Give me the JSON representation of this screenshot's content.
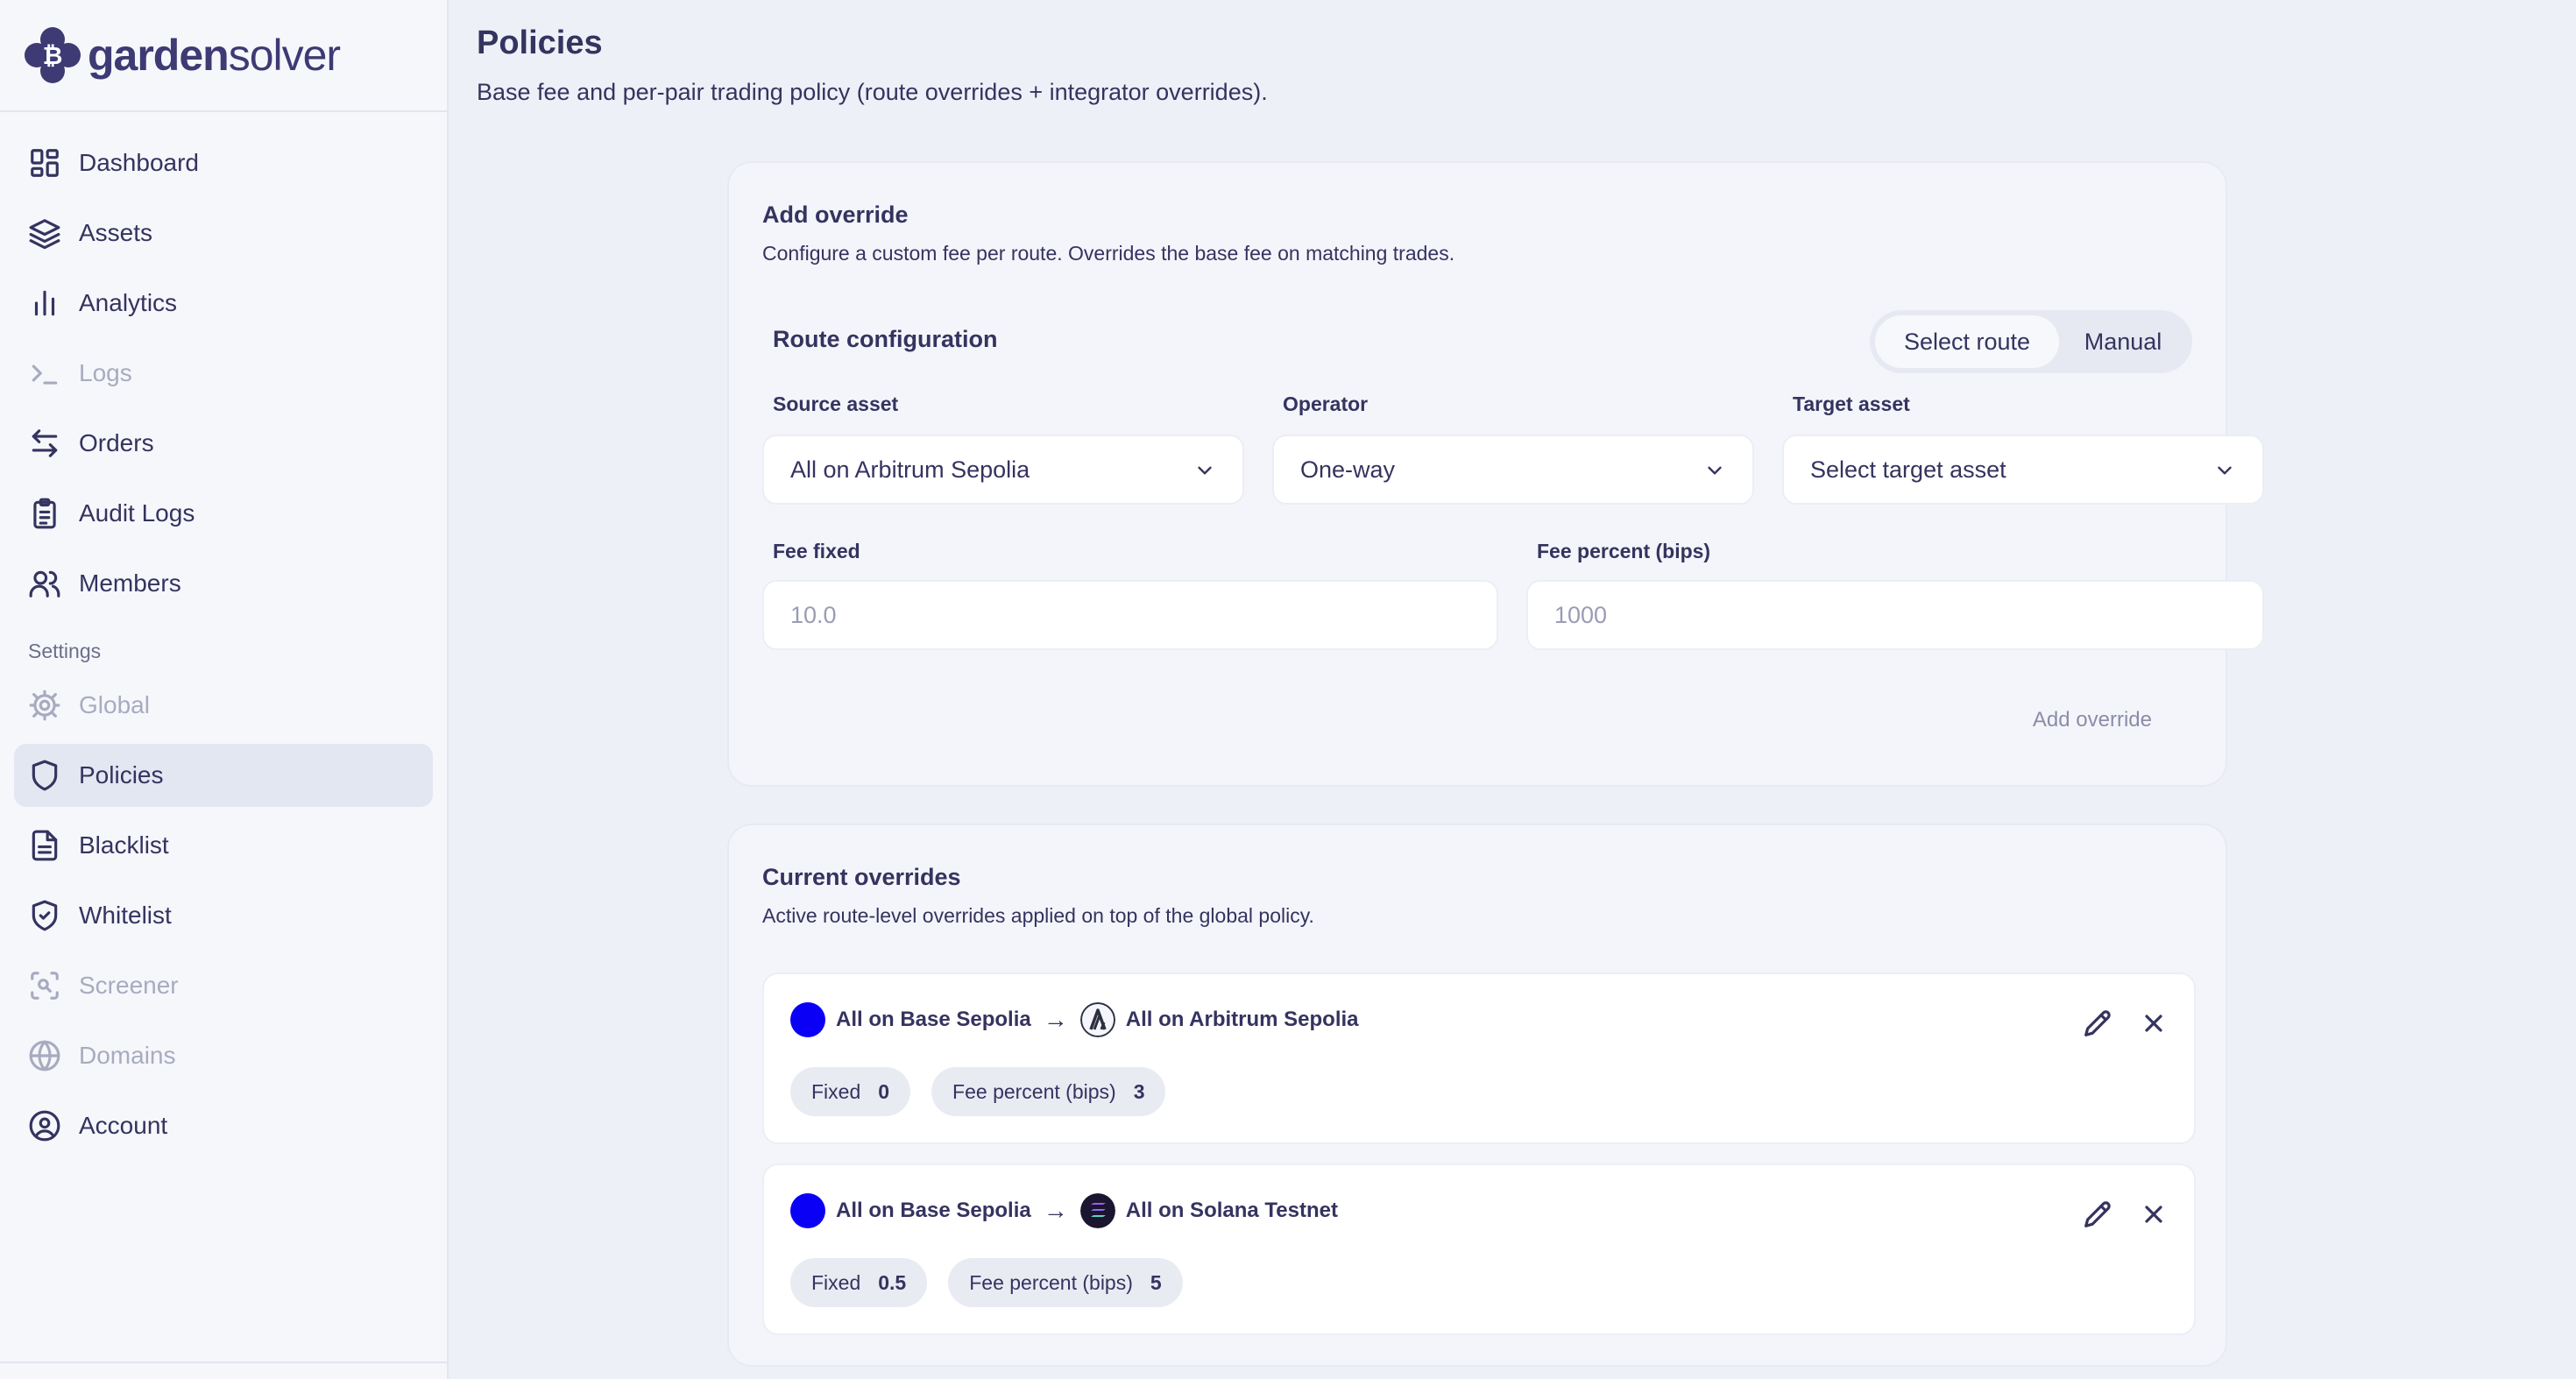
{
  "brand": {
    "name_bold": "garden",
    "name_light": "solver"
  },
  "nav": {
    "items": [
      {
        "label": "Dashboard",
        "icon": "dashboard-icon",
        "disabled": false
      },
      {
        "label": "Assets",
        "icon": "layers-icon",
        "disabled": false
      },
      {
        "label": "Analytics",
        "icon": "bar-chart-icon",
        "disabled": false
      },
      {
        "label": "Logs",
        "icon": "terminal-icon",
        "disabled": true
      },
      {
        "label": "Orders",
        "icon": "swap-icon",
        "disabled": false
      },
      {
        "label": "Audit Logs",
        "icon": "clipboard-icon",
        "disabled": false
      },
      {
        "label": "Members",
        "icon": "users-icon",
        "disabled": false
      }
    ],
    "settings_header": "Settings",
    "settings_items": [
      {
        "label": "Global",
        "icon": "gear-icon",
        "disabled": true
      },
      {
        "label": "Policies",
        "icon": "shield-icon",
        "active": true
      },
      {
        "label": "Blacklist",
        "icon": "file-icon",
        "disabled": false
      },
      {
        "label": "Whitelist",
        "icon": "shield-check-icon",
        "disabled": false
      },
      {
        "label": "Screener",
        "icon": "scan-icon",
        "disabled": true
      },
      {
        "label": "Domains",
        "icon": "globe-icon",
        "disabled": true
      },
      {
        "label": "Account",
        "icon": "user-circle-icon",
        "disabled": false
      }
    ]
  },
  "page": {
    "title": "Policies",
    "subtitle": "Base fee and per-pair trading policy (route overrides + integrator overrides)."
  },
  "add_override": {
    "title": "Add override",
    "description": "Configure a custom fee per route. Overrides the base fee on matching trades.",
    "route_config_title": "Route configuration",
    "mode_selected": "Select route",
    "mode_other": "Manual",
    "source_label": "Source asset",
    "source_value": "All on Arbitrum Sepolia",
    "operator_label": "Operator",
    "operator_value": "One-way",
    "target_label": "Target asset",
    "target_value": "Select target asset",
    "fee_fixed_label": "Fee fixed",
    "fee_fixed_placeholder": "10.0",
    "fee_percent_label": "Fee percent (bips)",
    "fee_percent_placeholder": "1000",
    "submit_label": "Add override"
  },
  "current_overrides": {
    "title": "Current overrides",
    "description": "Active route-level overrides applied on top of the global policy.",
    "arrow": "→",
    "items": [
      {
        "source": "All on Base Sepolia",
        "target": "All on Arbitrum Sepolia",
        "fixed_label": "Fixed",
        "fixed": "0",
        "percent_label": "Fee percent (bips)",
        "percent": "3"
      },
      {
        "source": "All on Base Sepolia",
        "target": "All on Solana Testnet",
        "fixed_label": "Fixed",
        "fixed": "0.5",
        "percent_label": "Fee percent (bips)",
        "percent": "5"
      }
    ]
  },
  "colors": {
    "accent": "#3d3a74",
    "base_chain": "#0a00f5",
    "background": "#eef0f8"
  }
}
